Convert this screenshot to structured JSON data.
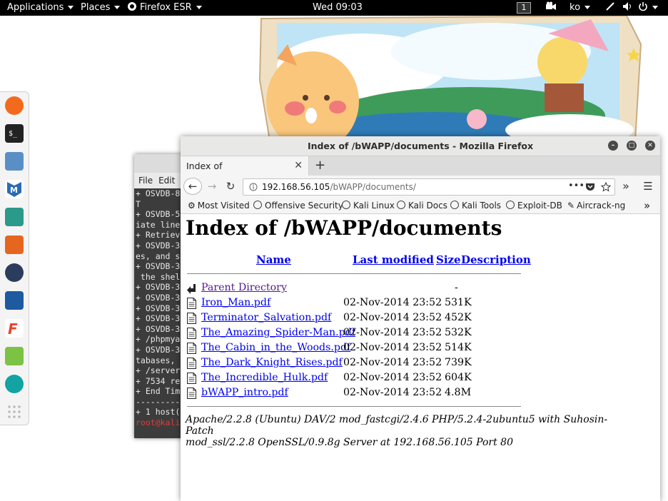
{
  "topbar": {
    "applications": "Applications",
    "places": "Places",
    "firefox": "Firefox ESR",
    "clock": "Wed 09:03",
    "workspace": "1",
    "lang": "ko"
  },
  "dock": {
    "items": [
      "firefox-icon",
      "terminal-icon",
      "files-icon",
      "metasploit-icon",
      "armitage-icon",
      "burpsuite-icon",
      "maltego-icon",
      "beef-icon",
      "faraday-icon",
      "leafpad-icon",
      "cherrytree-icon",
      "app-grid-icon"
    ]
  },
  "terminal": {
    "menu": [
      "File",
      "Edit"
    ],
    "lines": [
      "+ OSVDB-8",
      "T",
      "+ OSVDB-5",
      "iate line",
      "+ Retriev",
      "+ OSVDB-3",
      "es, and s",
      "+ OSVDB-3",
      " the shel",
      "+ OSVDB-3",
      "+ OSVDB-3",
      "+ OSVDB-3",
      "+ OSVDB-3",
      "+ OSVDB-3",
      "+ /phpmya",
      "+ OSVDB-3",
      "tabases,",
      "+ /server",
      "+ 7534 re",
      "+ End Tim",
      "---------",
      "+ 1 host("
    ],
    "prompt": "root@kali"
  },
  "firefox": {
    "window_title": "Index of /bWAPP/documents - Mozilla Firefox",
    "tab_title": "Index of /bWAPP/documents",
    "url_host": "192.168.56.105",
    "url_path": "/bWAPP/documents/",
    "bookmarks": [
      "Most Visited",
      "Offensive Security",
      "Kali Linux",
      "Kali Docs",
      "Kali Tools",
      "Exploit-DB",
      "Aircrack-ng"
    ]
  },
  "page": {
    "heading": "Index of /bWAPP/documents",
    "columns": {
      "name": "Name",
      "modified": "Last modified",
      "size": "Size",
      "description": "Description"
    },
    "parent": {
      "name": "Parent Directory",
      "size": "-"
    },
    "files": [
      {
        "name": "Iron_Man.pdf",
        "modified": "02-Nov-2014 23:52",
        "size": "531K"
      },
      {
        "name": "Terminator_Salvation.pdf",
        "modified": "02-Nov-2014 23:52",
        "size": "452K"
      },
      {
        "name": "The_Amazing_Spider-Man.pdf",
        "modified": "02-Nov-2014 23:52",
        "size": "532K"
      },
      {
        "name": "The_Cabin_in_the_Woods.pdf",
        "modified": "02-Nov-2014 23:52",
        "size": "514K"
      },
      {
        "name": "The_Dark_Knight_Rises.pdf",
        "modified": "02-Nov-2014 23:52",
        "size": "739K"
      },
      {
        "name": "The_Incredible_Hulk.pdf",
        "modified": "02-Nov-2014 23:52",
        "size": "604K"
      },
      {
        "name": "bWAPP_intro.pdf",
        "modified": "02-Nov-2014 23:52",
        "size": "4.8M"
      }
    ],
    "server_signature_1": "Apache/2.2.8 (Ubuntu) DAV/2 mod_fastcgi/2.4.6 PHP/5.2.4-2ubuntu5 with Suhosin-Patch",
    "server_signature_2": "mod_ssl/2.2.8 OpenSSL/0.9.8g Server at 192.168.56.105 Port 80"
  },
  "colors": {
    "link": "#0000ee",
    "visited": "#551a8b",
    "panel": "#000000",
    "terminal_bg": "#3c3c3c",
    "prompt": "#e23b3b"
  }
}
